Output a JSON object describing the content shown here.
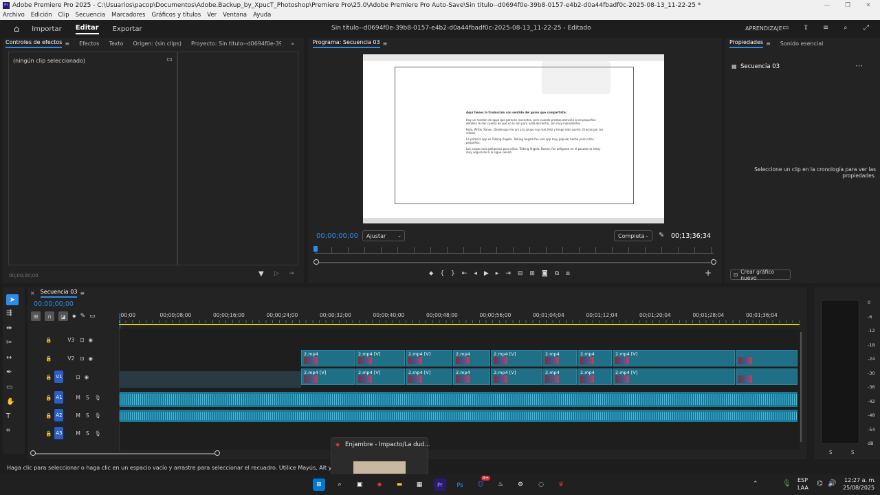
{
  "window": {
    "title": "Adobe Premiere Pro 2025 - C:\\Usuarios\\pacop\\Documentos\\Adobe.Backup_by_XpucT_Photoshop\\Premiere Pro\\25.0\\Adobe Premiere Pro Auto-Save\\Sin título--d0694f0e-39b8-0157-e4b2-d0a44fbadf0c-2025-08-13_11-22-25 *",
    "logo": "Pr"
  },
  "menubar": [
    "Archivo",
    "Edición",
    "Clip",
    "Secuencia",
    "Marcadores",
    "Gráficos y títulos",
    "Ver",
    "Ventana",
    "Ayuda"
  ],
  "header": {
    "tabs": [
      "Importar",
      "Editar",
      "Exportar"
    ],
    "active_tab": "Editar",
    "project_title": "Sin título--d0694f0e-39b8-0157-e4b2-d0a44fbadf0c-2025-08-13_11-22-25 - Editado",
    "learning": "APRENDIZAJE"
  },
  "effects_panel": {
    "tabs": [
      "Controles de efectos",
      "Efectos",
      "Texto",
      "Origen: (sin clips)",
      "Proyecto: Sin título--d0694f0e-39b8-0157-e4b"
    ],
    "no_clip": "(ningún clip seleccionado)",
    "timecode": "00;00;00;00"
  },
  "program_monitor": {
    "title": "Programa: Secuencia 03",
    "timecode_current": "00;00;00;00",
    "fit": "Ajustar",
    "quality": "Completa",
    "timecode_duration": "00;13;36;34",
    "playhead_fraction": 0.0,
    "preview_text": {
      "heading": "Aquí tienes la traducción con sentido del guion que compartiste:",
      "p1": "Hay un montón de apps que parecen inocentes, pero cuando prestas atención a los pequeños detalles te das cuenta de que no lo son para nada de hecho, son muy inquietantes.",
      "p2": "Hola, Writer Xanon. Desde que me uní a tu grupo soy más feliz y tengo más suerte. Gracias por tus videos.",
      "p3": "La primera app es Talking Angela. Talking Angela fue una app muy popular hecha para niños pequeños.",
      "p4": "Los juegos más peligrosos para niños: Talking Angela. Bueno, fue peligroso en el pasado no estoy muy segura de si lo sigue siendo."
    }
  },
  "properties_panel": {
    "tabs": [
      "Propiedades",
      "Sonido esencial"
    ],
    "sequence_name": "Secuencia 03",
    "message": "Seleccione un clip en la cronología para ver las propiedades.",
    "create_graphic": "Crear gráfico nuevo"
  },
  "timeline": {
    "sequence_tab": "Secuencia 03",
    "timecode": "00;00;00;00",
    "ruler_labels": [
      ";00;00",
      "00;00;08;00",
      "00;00;16;00",
      "00;00;24;00",
      "00;00;32;00",
      "00;00;40;00",
      "00;00;48;00",
      "00;00;56;00",
      "00;01;04;04",
      "00;01;12;04",
      "00;01;20;04",
      "00;01;28;04",
      "00;01;36;04"
    ],
    "tracks": [
      {
        "name": "V3",
        "targeted": false
      },
      {
        "name": "V2",
        "targeted": false
      },
      {
        "name": "V1",
        "targeted": true
      },
      {
        "name": "A1",
        "targeted": true
      },
      {
        "name": "A2",
        "targeted": true
      },
      {
        "name": "A3",
        "targeted": true
      }
    ],
    "track_controls": {
      "mute": "M",
      "solo": "S"
    },
    "clip_label": "2.mp4 [V]",
    "clip_label_short": "2.mp4",
    "fx": "fx"
  },
  "audio_meter": {
    "scale": [
      "0",
      "-6",
      "-12",
      "-18",
      "-24",
      "-30",
      "-36",
      "-42",
      "-48",
      "-54",
      "dB"
    ],
    "channels": [
      "S",
      "S"
    ]
  },
  "status_bar": {
    "message": "Haga clic para seleccionar o haga clic en un espacio vacío y arrastre para seleccionar el recuadro. Utilice Mayús, Alt y Ctrl para otras opciones."
  },
  "taskbar_preview": {
    "title": "Enjambre - Impacto/La dud..."
  },
  "taskbar": {
    "language": "ESP",
    "layout": "LAA",
    "time": "12:27 a. m.",
    "date": "25/08/2025",
    "badge": "9+"
  },
  "colors": {
    "accent_blue": "#2d8ceb",
    "clip_teal": "#1f6f86",
    "work_area_yellow": "#d8d000",
    "target_blue": "#2a5ec8"
  }
}
